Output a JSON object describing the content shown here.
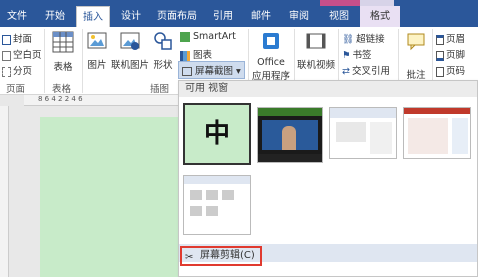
{
  "tabs": [
    {
      "label": "文件"
    },
    {
      "label": "开始"
    },
    {
      "label": "插入"
    },
    {
      "label": "设计"
    },
    {
      "label": "页面布局"
    },
    {
      "label": "引用"
    },
    {
      "label": "邮件"
    },
    {
      "label": "审阅"
    },
    {
      "label": "视图"
    },
    {
      "label": "格式"
    }
  ],
  "ribbon": {
    "pages": {
      "cover": "封面",
      "blank": "空白页",
      "break": "分页",
      "group": "页面"
    },
    "table": {
      "label": "表格",
      "group": "表格"
    },
    "illustrations": {
      "picture": "图片",
      "online_picture": "联机图片",
      "shapes": "形状",
      "group": "插图",
      "smartart": "SmartArt",
      "chart": "图表",
      "screenshot": "屏幕截图"
    },
    "apps": {
      "office_line1": "Office",
      "office_line2": "应用程序"
    },
    "media": {
      "online_video": "联机视频"
    },
    "links": {
      "hyperlink": "超链接",
      "bookmark": "书签",
      "crossref": "交叉引用"
    },
    "comments": {
      "comment": "批注"
    },
    "header_footer": {
      "header": "页眉",
      "footer": "页脚",
      "page_number": "页码"
    }
  },
  "ruler": {
    "ticks": "8  6  4  2     2  4  6"
  },
  "dropdown": {
    "header": "可用 视窗",
    "thumb1_char": "中",
    "clip_label": "屏幕剪辑(C)"
  }
}
